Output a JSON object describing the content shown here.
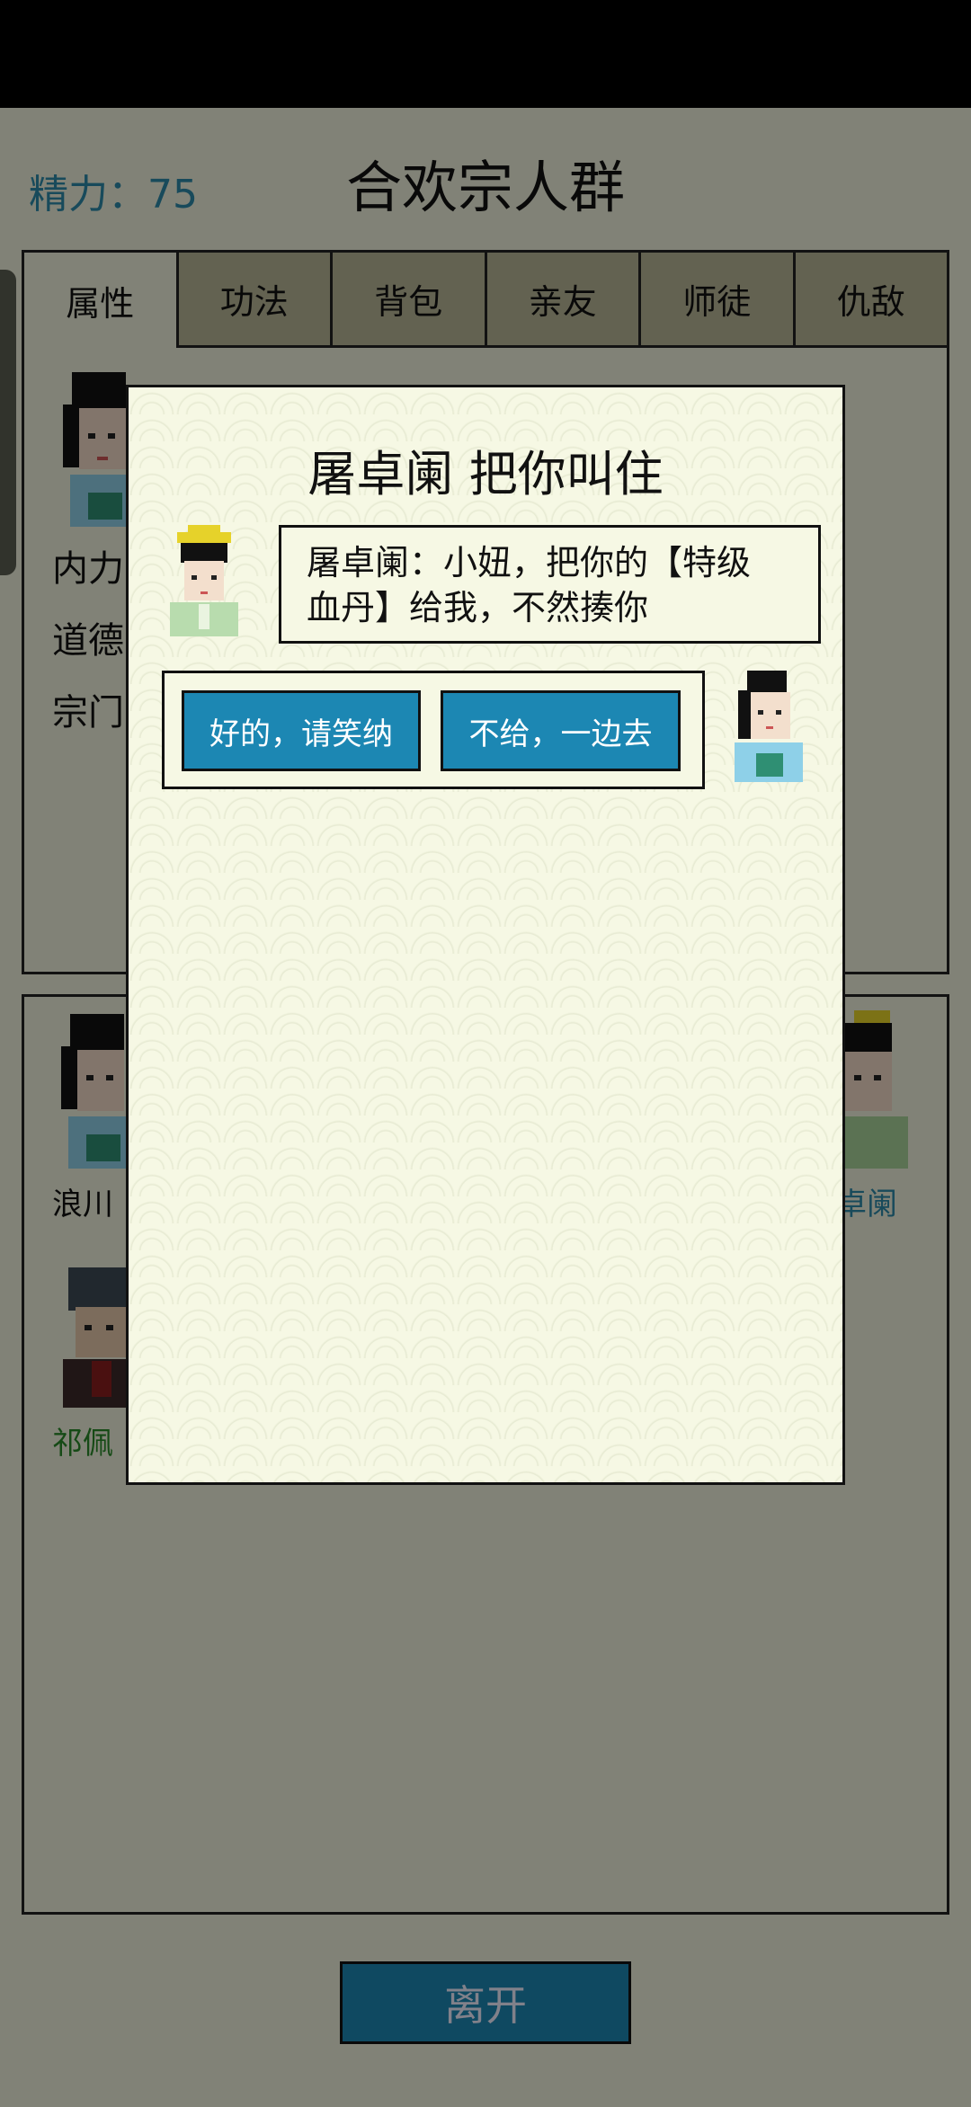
{
  "header": {
    "stats": "精力：75",
    "title": "合欢宗人群"
  },
  "tabs": [
    "属性",
    "功法",
    "背包",
    "亲友",
    "师徒",
    "仇敌"
  ],
  "attributes": [
    "内力",
    "道德",
    "宗门"
  ],
  "crowd": {
    "names": [
      "浪川",
      "祁佩",
      "卓阑"
    ]
  },
  "footer": {
    "leave_label": "离开"
  },
  "dialog": {
    "title": "屠卓阑 把你叫住",
    "speech_line1": "屠卓阑：小妞，把你的【特级",
    "speech_line2": "血丹】给我，不然揍你",
    "options": [
      "好的，请笑纳",
      "不给，一边去"
    ]
  },
  "colors": {
    "button": "#1c87b3",
    "stats_text": "#2d8aa8",
    "panel_bg": "#eef0dc",
    "tab_inactive": "#b8b596"
  }
}
